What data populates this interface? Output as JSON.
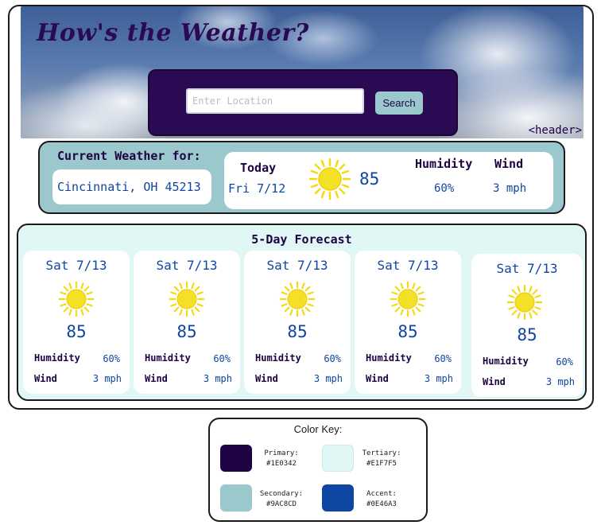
{
  "header": {
    "title": "How's the Weather?",
    "search_placeholder": "Enter Location",
    "search_button": "Search",
    "tag": "<header>"
  },
  "current": {
    "label": "Current Weather for:",
    "location": "Cincinnati, OH 45213",
    "today_label": "Today",
    "date": "Fri 7/12",
    "icon": "sun-icon",
    "temp": "85",
    "humidity_label": "Humidity",
    "humidity": "60%",
    "wind_label": "Wind",
    "wind": "3 mph"
  },
  "forecast": {
    "title": "5-Day Forecast",
    "days": [
      {
        "date": "Sat 7/13",
        "icon": "sun-icon",
        "temp": "85",
        "humidity_label": "Humidity",
        "humidity": "60%",
        "wind_label": "Wind",
        "wind": "3 mph"
      },
      {
        "date": "Sat 7/13",
        "icon": "sun-icon",
        "temp": "85",
        "humidity_label": "Humidity",
        "humidity": "60%",
        "wind_label": "Wind",
        "wind": "3 mph"
      },
      {
        "date": "Sat 7/13",
        "icon": "sun-icon",
        "temp": "85",
        "humidity_label": "Humidity",
        "humidity": "60%",
        "wind_label": "Wind",
        "wind": "3 mph"
      },
      {
        "date": "Sat 7/13",
        "icon": "sun-icon",
        "temp": "85",
        "humidity_label": "Humidity",
        "humidity": "60%",
        "wind_label": "Wind",
        "wind": "3 mph"
      },
      {
        "date": "Sat 7/13",
        "icon": "sun-icon",
        "temp": "85",
        "humidity_label": "Humidity",
        "humidity": "60%",
        "wind_label": "Wind",
        "wind": "3 mph"
      }
    ]
  },
  "color_key": {
    "title": "Color Key:",
    "colors": [
      {
        "label": "Primary:",
        "hex": "#1E0342"
      },
      {
        "label": "Tertiary:",
        "hex": "#E1F7F5"
      },
      {
        "label": "Secondary:",
        "hex": "#9AC8CD"
      },
      {
        "label": "Accent:",
        "hex": "#0E46A3"
      }
    ]
  }
}
